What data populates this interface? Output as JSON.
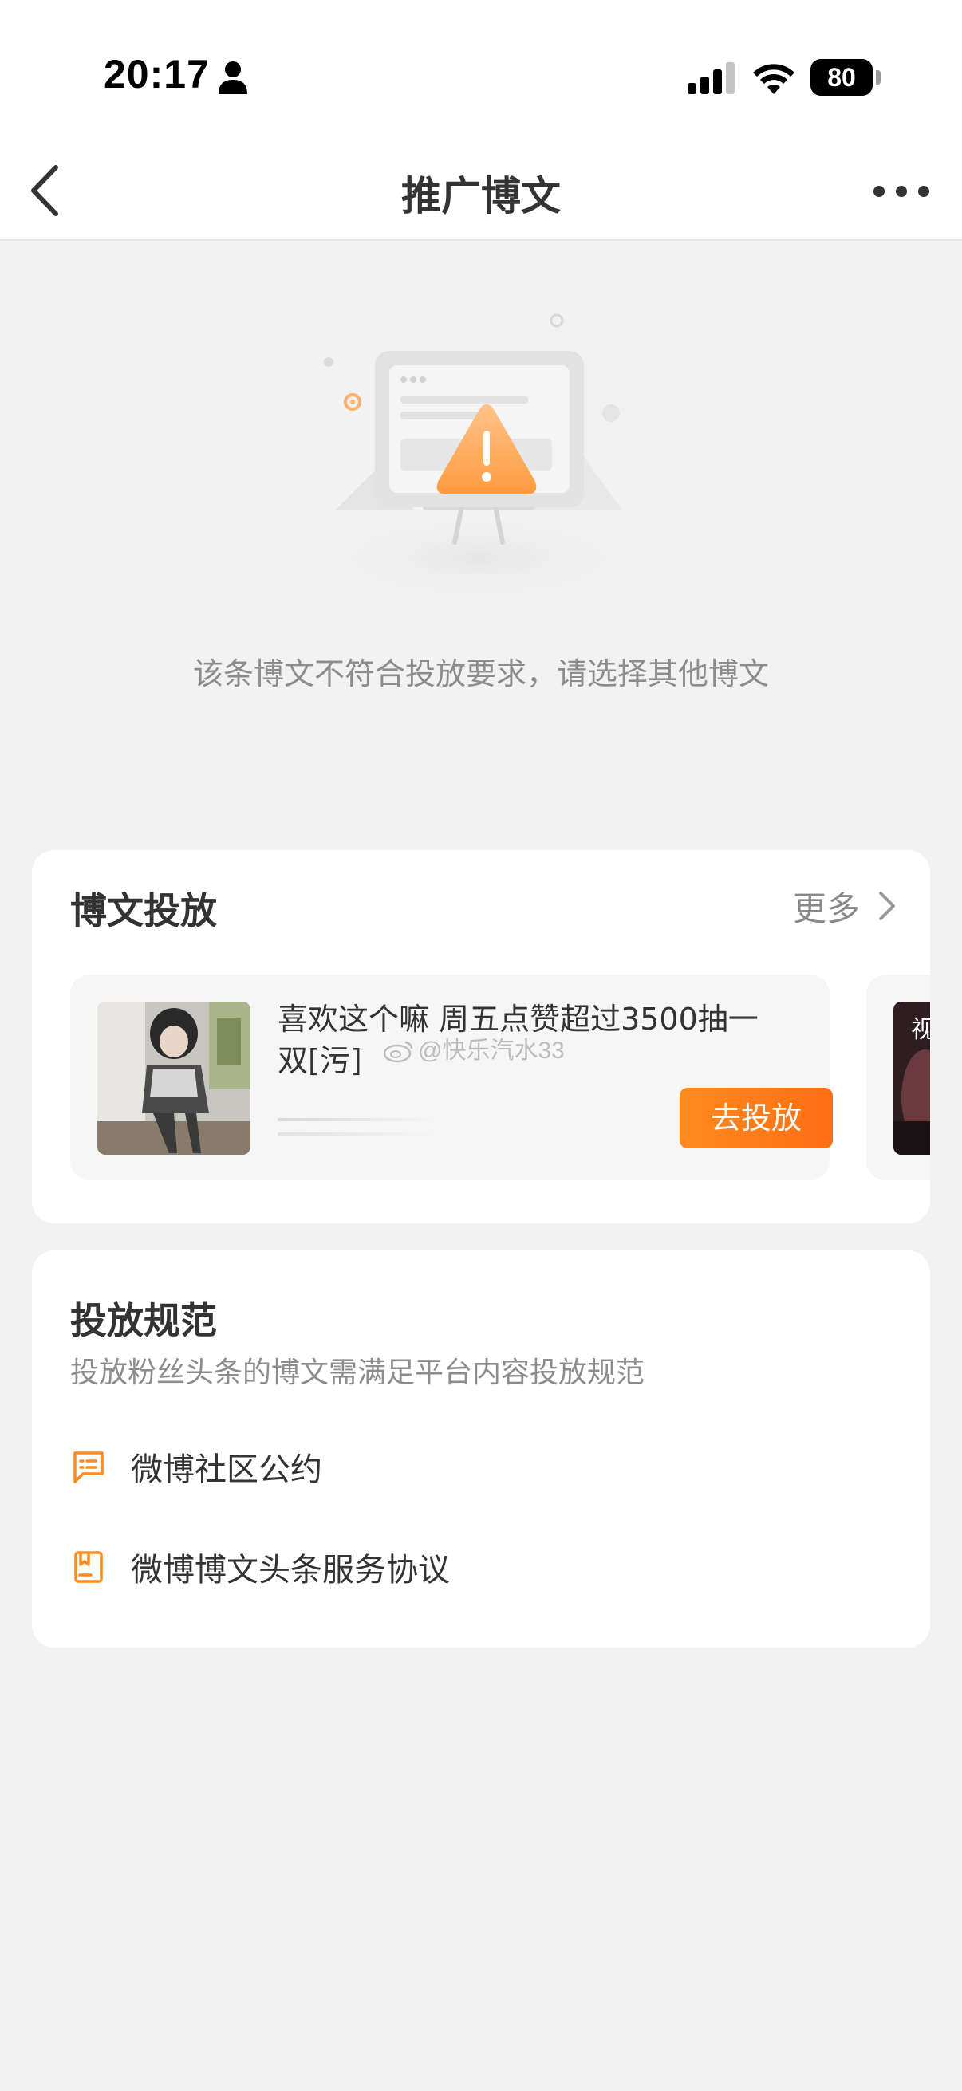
{
  "status_bar": {
    "time": "20:17",
    "battery": "80"
  },
  "nav": {
    "title": "推广博文"
  },
  "empty_state": {
    "message": "该条博文不符合投放要求，请选择其他博文"
  },
  "promo_section": {
    "title": "博文投放",
    "more_label": "更多",
    "posts": [
      {
        "text": "喜欢这个嘛 周五点赞超过3500抽一双[污]",
        "button_label": "去投放"
      }
    ],
    "peek_char": "视"
  },
  "watermark": "@快乐汽水33",
  "rules_section": {
    "title": "投放规范",
    "subtitle": "投放粉丝头条的博文需满足平台内容投放规范",
    "links": [
      {
        "label": "微博社区公约",
        "icon": "message-square-icon"
      },
      {
        "label": "微博博文头条服务协议",
        "icon": "bookmark-book-icon"
      }
    ]
  },
  "colors": {
    "accent": "#ff7a17",
    "background": "#f2f2f2",
    "card": "#ffffff"
  }
}
